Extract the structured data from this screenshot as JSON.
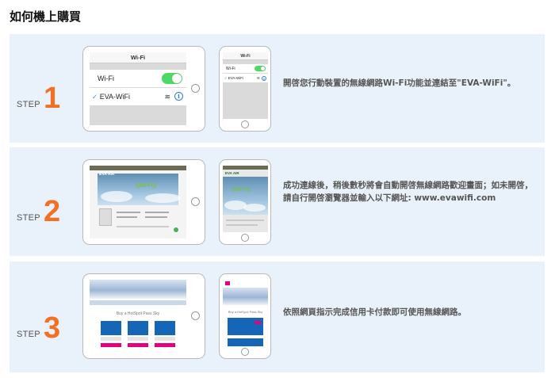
{
  "page": {
    "title": "如何機上購買"
  },
  "steps": [
    {
      "step_word": "STEP",
      "step_number": "1",
      "description": "開啓您行動裝置的無線網路Wi-Fi功能並連結至\"EVA-WiFi\"。",
      "tablet_screen": {
        "header": "Wi-Fi",
        "wifi_label": "Wi-Fi",
        "network": "EVA-WiFi",
        "check_mark": "✓",
        "signal": "≋",
        "info": "i"
      },
      "phone_screen": {
        "header": "Wi-Fi",
        "wifi_label": "Wi-Fi",
        "network": "EVA-WiFi",
        "check_mark": "✓",
        "signal": "≋",
        "info": "i"
      }
    },
    {
      "step_word": "STEP",
      "step_number": "2",
      "description": "成功連線後，稍後數秒將會自動開啓無線網路歡迎畫面；如未開啓，請自行開啓瀏覽器並輸入以下網址: www.evawifi.com",
      "tablet_screen": {
        "logo": "EVA AIR",
        "wifi_mark": "((Wi-Fi))"
      },
      "phone_screen": {
        "logo": "EVA AIR",
        "wifi_mark": "((Wi-Fi))"
      }
    },
    {
      "step_word": "STEP",
      "step_number": "3",
      "description": "依照網頁指示完成信用卡付款即可使用無線網路。",
      "tablet_screen": {
        "title": "Buy a HotSpot Pass Sky"
      },
      "phone_screen": {
        "title": "Buy a HotSpot Pass Sky"
      }
    }
  ],
  "colors": {
    "accent": "#f36f21",
    "panel_bg": "#e9f2fb",
    "toggle_green": "#4cd964",
    "plan_blue": "#1666b8",
    "plan_pink": "#e6007e"
  }
}
